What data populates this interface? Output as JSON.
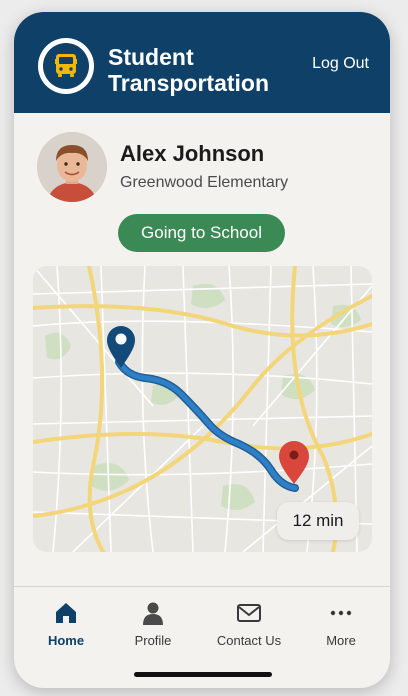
{
  "header": {
    "title_line1": "Student",
    "title_line2": "Transportation",
    "logout_label": "Log Out",
    "logo_icon": "bus-icon"
  },
  "student": {
    "name": "Alex Johnson",
    "school": "Greenwood Elementary",
    "status": "Going to School"
  },
  "map": {
    "eta": "12 min",
    "start_icon": "map-pin-icon",
    "end_icon": "map-pin-icon"
  },
  "tabs": [
    {
      "label": "Home",
      "icon": "home-icon",
      "active": true
    },
    {
      "label": "Profile",
      "icon": "person-icon",
      "active": false
    },
    {
      "label": "Contact Us",
      "icon": "mail-icon",
      "active": false
    },
    {
      "label": "More",
      "icon": "more-icon",
      "active": false
    }
  ],
  "colors": {
    "brand": "#0f4068",
    "status_green": "#3b8a55",
    "route_blue": "#2f7fc6",
    "destination_red": "#d9463b",
    "background": "#f3f2ef"
  }
}
